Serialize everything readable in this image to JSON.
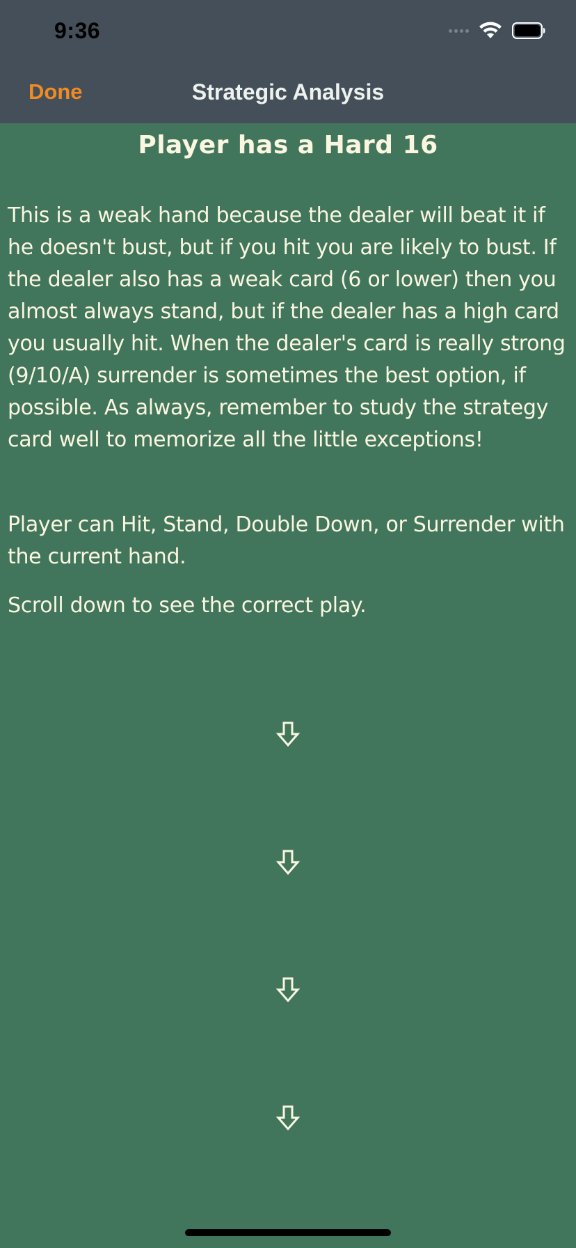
{
  "status_bar": {
    "time": "9:36"
  },
  "nav": {
    "done_label": "Done",
    "title": "Strategic Analysis"
  },
  "content": {
    "heading": "Player has a Hard 16",
    "paragraphs": [
      "This is a weak hand because the dealer will beat it if he doesn't bust, but if you hit you are likely to bust.  If the dealer also has a weak card (6 or lower) then you almost always stand, but if the dealer has a high card you usually hit. When the dealer's card is really strong (9/10/A) surrender is sometimes the best option, if possible. As always, remember to study the strategy card well to memorize all the little exceptions!",
      "Player can Hit, Stand, Double Down, or Surrender with the current hand.",
      "Scroll down to see the correct play."
    ],
    "arrow_icon": "down-arrow-icon"
  },
  "colors": {
    "background": "#41755c",
    "nav_bar": "#444f59",
    "accent": "#f08a24",
    "text": "#fbf6e0"
  }
}
